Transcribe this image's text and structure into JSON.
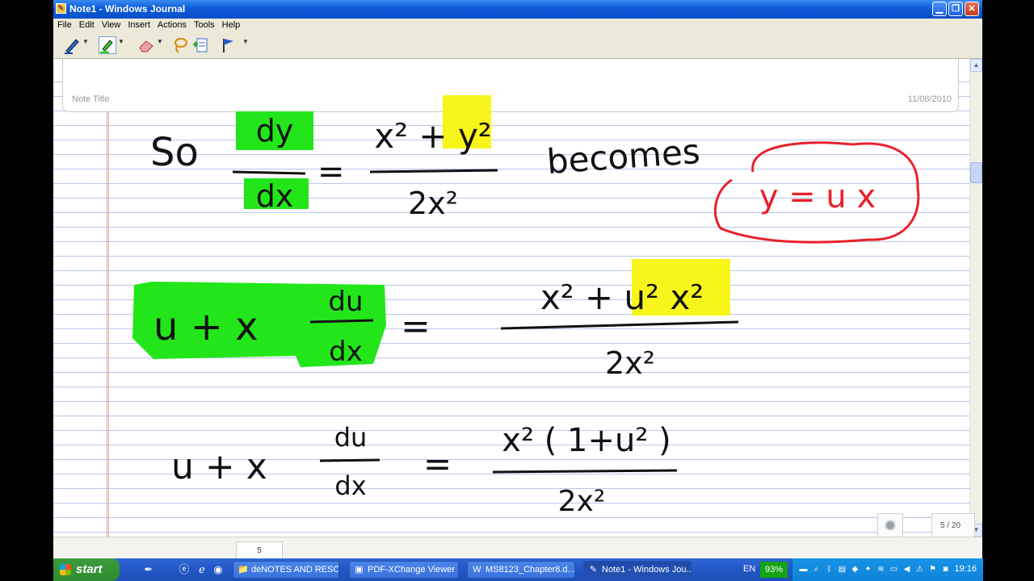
{
  "window": {
    "title": "Note1 - Windows Journal"
  },
  "menu": [
    "File",
    "Edit",
    "View",
    "Insert",
    "Actions",
    "Tools",
    "Help"
  ],
  "toolbar": {
    "tools": [
      "pen-icon",
      "highlighter-icon",
      "eraser-icon",
      "lasso-icon",
      "insert-space-icon",
      "flag-icon"
    ]
  },
  "note": {
    "title_label": "Note Title",
    "date": "11/08/2010",
    "page_counter": "5 / 20",
    "page_tab": "5",
    "handwriting": {
      "line1": {
        "prefix": "So",
        "lhs_num": "dy",
        "lhs_den": "dx",
        "rhs_num": "x² + y²",
        "rhs_den": "2x²",
        "suffix": "becomes"
      },
      "callout": "y = u x",
      "line2": {
        "lhs": "u + x",
        "lhs_num": "du",
        "lhs_den": "dx",
        "rhs_num": "x² + u² x²",
        "rhs_den": "2x²"
      },
      "line3": {
        "lhs": "u + x",
        "lhs_num": "du",
        "lhs_den": "dx",
        "rhs_num": "x² ( 1+u² )",
        "rhs_den": "2x²"
      }
    },
    "colors": {
      "ink": "#111111",
      "highlight_green": "#22e61a",
      "highlight_yellow": "#f7f51a",
      "callout_red": "#e8202a"
    }
  },
  "taskbar": {
    "start_label": "start",
    "tasks": [
      {
        "label": "deNOTES AND RESO...",
        "icon": "folder-icon"
      },
      {
        "label": "PDF-XChange Viewer ...",
        "icon": "pdf-icon"
      },
      {
        "label": "MS8123_Chapter8.d...",
        "icon": "word-icon"
      },
      {
        "label": "Note1 - Windows Jou...",
        "icon": "journal-icon",
        "active": true
      }
    ],
    "language": "EN",
    "zoom": "93%",
    "clock": "19:16"
  }
}
